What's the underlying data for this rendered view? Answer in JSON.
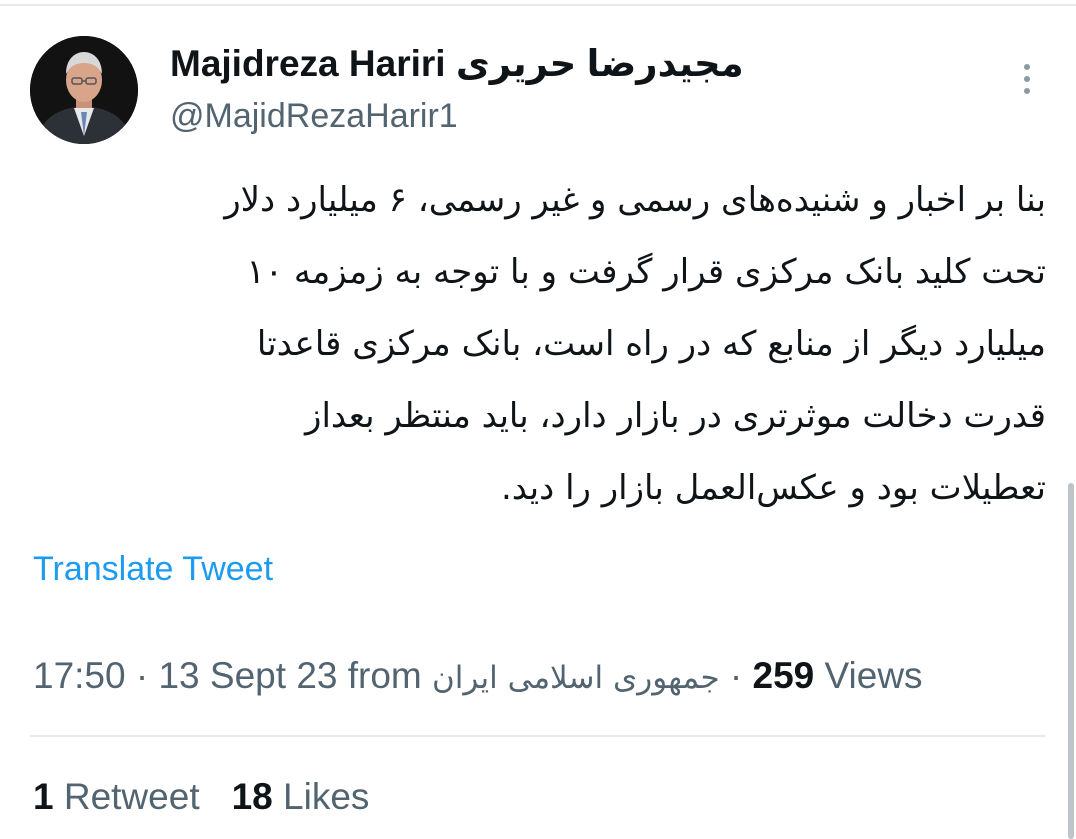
{
  "tweet": {
    "author": {
      "display_name": "Majidreza Hariri مجیدرضا حریری",
      "handle": "@MajidRezaHarir1"
    },
    "text": "بنا بر اخبار و شنیده‌های رسمی و غیر رسمی، ۶ میلیارد دلار\nتحت کلید بانک مرکزی قرار گرفت و با توجه به زمزمه ۱۰\nمیلیارد دیگر از منابع که در راه است، بانک مرکزی قاعدتا\nقدرت دخالت موثرتری در بازار دارد، باید منتظر بعداز\nتعطیلات بود و عکس‌العمل بازار را دید.",
    "translate_label": "Translate Tweet",
    "time": "17:50",
    "separator": "·",
    "date": "13 Sept 23",
    "from_label": "from",
    "source": "جمهوری اسلامی ایران",
    "views_count": "259",
    "views_label": "Views",
    "retweets_count": "1",
    "retweets_label": "Retweet",
    "likes_count": "18",
    "likes_label": "Likes"
  },
  "icons": {
    "more": "more-options-icon"
  },
  "colors": {
    "link": "#1d9bf0",
    "secondary_text": "#536471",
    "primary_text": "#0f1419",
    "divider": "#e7e9ea"
  }
}
